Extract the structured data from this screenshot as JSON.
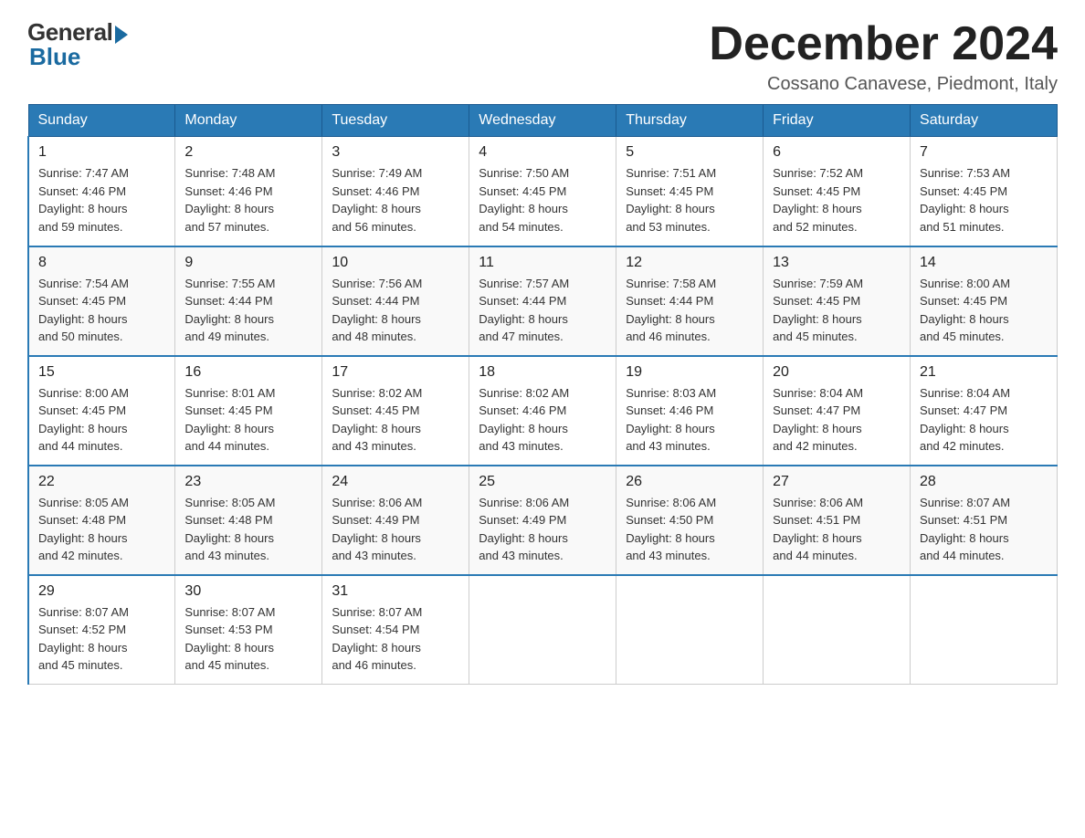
{
  "header": {
    "logo_general": "General",
    "logo_blue": "Blue",
    "month_title": "December 2024",
    "location": "Cossano Canavese, Piedmont, Italy"
  },
  "weekdays": [
    "Sunday",
    "Monday",
    "Tuesday",
    "Wednesday",
    "Thursday",
    "Friday",
    "Saturday"
  ],
  "weeks": [
    [
      {
        "day": "1",
        "sunrise": "7:47 AM",
        "sunset": "4:46 PM",
        "daylight": "8 hours and 59 minutes."
      },
      {
        "day": "2",
        "sunrise": "7:48 AM",
        "sunset": "4:46 PM",
        "daylight": "8 hours and 57 minutes."
      },
      {
        "day": "3",
        "sunrise": "7:49 AM",
        "sunset": "4:46 PM",
        "daylight": "8 hours and 56 minutes."
      },
      {
        "day": "4",
        "sunrise": "7:50 AM",
        "sunset": "4:45 PM",
        "daylight": "8 hours and 54 minutes."
      },
      {
        "day": "5",
        "sunrise": "7:51 AM",
        "sunset": "4:45 PM",
        "daylight": "8 hours and 53 minutes."
      },
      {
        "day": "6",
        "sunrise": "7:52 AM",
        "sunset": "4:45 PM",
        "daylight": "8 hours and 52 minutes."
      },
      {
        "day": "7",
        "sunrise": "7:53 AM",
        "sunset": "4:45 PM",
        "daylight": "8 hours and 51 minutes."
      }
    ],
    [
      {
        "day": "8",
        "sunrise": "7:54 AM",
        "sunset": "4:45 PM",
        "daylight": "8 hours and 50 minutes."
      },
      {
        "day": "9",
        "sunrise": "7:55 AM",
        "sunset": "4:44 PM",
        "daylight": "8 hours and 49 minutes."
      },
      {
        "day": "10",
        "sunrise": "7:56 AM",
        "sunset": "4:44 PM",
        "daylight": "8 hours and 48 minutes."
      },
      {
        "day": "11",
        "sunrise": "7:57 AM",
        "sunset": "4:44 PM",
        "daylight": "8 hours and 47 minutes."
      },
      {
        "day": "12",
        "sunrise": "7:58 AM",
        "sunset": "4:44 PM",
        "daylight": "8 hours and 46 minutes."
      },
      {
        "day": "13",
        "sunrise": "7:59 AM",
        "sunset": "4:45 PM",
        "daylight": "8 hours and 45 minutes."
      },
      {
        "day": "14",
        "sunrise": "8:00 AM",
        "sunset": "4:45 PM",
        "daylight": "8 hours and 45 minutes."
      }
    ],
    [
      {
        "day": "15",
        "sunrise": "8:00 AM",
        "sunset": "4:45 PM",
        "daylight": "8 hours and 44 minutes."
      },
      {
        "day": "16",
        "sunrise": "8:01 AM",
        "sunset": "4:45 PM",
        "daylight": "8 hours and 44 minutes."
      },
      {
        "day": "17",
        "sunrise": "8:02 AM",
        "sunset": "4:45 PM",
        "daylight": "8 hours and 43 minutes."
      },
      {
        "day": "18",
        "sunrise": "8:02 AM",
        "sunset": "4:46 PM",
        "daylight": "8 hours and 43 minutes."
      },
      {
        "day": "19",
        "sunrise": "8:03 AM",
        "sunset": "4:46 PM",
        "daylight": "8 hours and 43 minutes."
      },
      {
        "day": "20",
        "sunrise": "8:04 AM",
        "sunset": "4:47 PM",
        "daylight": "8 hours and 42 minutes."
      },
      {
        "day": "21",
        "sunrise": "8:04 AM",
        "sunset": "4:47 PM",
        "daylight": "8 hours and 42 minutes."
      }
    ],
    [
      {
        "day": "22",
        "sunrise": "8:05 AM",
        "sunset": "4:48 PM",
        "daylight": "8 hours and 42 minutes."
      },
      {
        "day": "23",
        "sunrise": "8:05 AM",
        "sunset": "4:48 PM",
        "daylight": "8 hours and 43 minutes."
      },
      {
        "day": "24",
        "sunrise": "8:06 AM",
        "sunset": "4:49 PM",
        "daylight": "8 hours and 43 minutes."
      },
      {
        "day": "25",
        "sunrise": "8:06 AM",
        "sunset": "4:49 PM",
        "daylight": "8 hours and 43 minutes."
      },
      {
        "day": "26",
        "sunrise": "8:06 AM",
        "sunset": "4:50 PM",
        "daylight": "8 hours and 43 minutes."
      },
      {
        "day": "27",
        "sunrise": "8:06 AM",
        "sunset": "4:51 PM",
        "daylight": "8 hours and 44 minutes."
      },
      {
        "day": "28",
        "sunrise": "8:07 AM",
        "sunset": "4:51 PM",
        "daylight": "8 hours and 44 minutes."
      }
    ],
    [
      {
        "day": "29",
        "sunrise": "8:07 AM",
        "sunset": "4:52 PM",
        "daylight": "8 hours and 45 minutes."
      },
      {
        "day": "30",
        "sunrise": "8:07 AM",
        "sunset": "4:53 PM",
        "daylight": "8 hours and 45 minutes."
      },
      {
        "day": "31",
        "sunrise": "8:07 AM",
        "sunset": "4:54 PM",
        "daylight": "8 hours and 46 minutes."
      },
      null,
      null,
      null,
      null
    ]
  ]
}
